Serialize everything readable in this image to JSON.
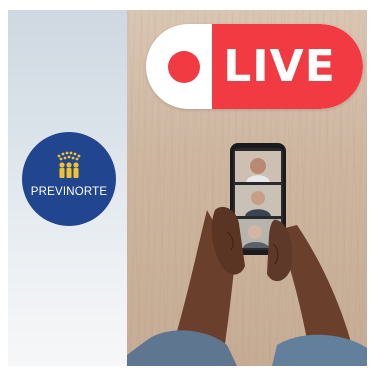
{
  "badge": {
    "label": "LIVE",
    "dot_color": "#f13a41",
    "bg_color": "#f13a41"
  },
  "logo": {
    "name": "PREVINORTE",
    "bg_color": "#21458e",
    "mark_color": "#f2c12e"
  },
  "photo": {
    "icons": [
      "hands-icon",
      "smartphone-icon",
      "video-call-participant-icon"
    ],
    "call_participants": 3
  }
}
